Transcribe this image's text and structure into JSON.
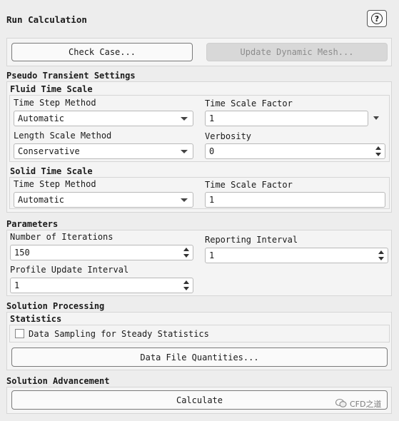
{
  "panel": {
    "title": "Run Calculation",
    "help_icon": "?"
  },
  "top_buttons": {
    "check_case": "Check Case...",
    "update_dynamic_mesh": "Update Dynamic Mesh..."
  },
  "pseudo_transient": {
    "title": "Pseudo Transient Settings",
    "fluid": {
      "title": "Fluid Time Scale",
      "time_step_method_label": "Time Step Method",
      "time_step_method_value": "Automatic",
      "time_scale_factor_label": "Time Scale Factor",
      "time_scale_factor_value": "1",
      "length_scale_method_label": "Length Scale Method",
      "length_scale_method_value": "Conservative",
      "verbosity_label": "Verbosity",
      "verbosity_value": "0"
    },
    "solid": {
      "title": "Solid Time Scale",
      "time_step_method_label": "Time Step Method",
      "time_step_method_value": "Automatic",
      "time_scale_factor_label": "Time Scale Factor",
      "time_scale_factor_value": "1"
    }
  },
  "parameters": {
    "title": "Parameters",
    "iterations_label": "Number of Iterations",
    "iterations_value": "150",
    "reporting_interval_label": "Reporting Interval",
    "reporting_interval_value": "1",
    "profile_update_label": "Profile Update Interval",
    "profile_update_value": "1"
  },
  "solution_processing": {
    "title": "Solution Processing",
    "statistics_title": "Statistics",
    "data_sampling_label": "Data Sampling for Steady Statistics",
    "data_sampling_checked": false,
    "data_file_quantities": "Data File Quantities..."
  },
  "solution_advancement": {
    "title": "Solution Advancement",
    "calculate": "Calculate"
  },
  "watermark": {
    "text": "CFD之道"
  }
}
